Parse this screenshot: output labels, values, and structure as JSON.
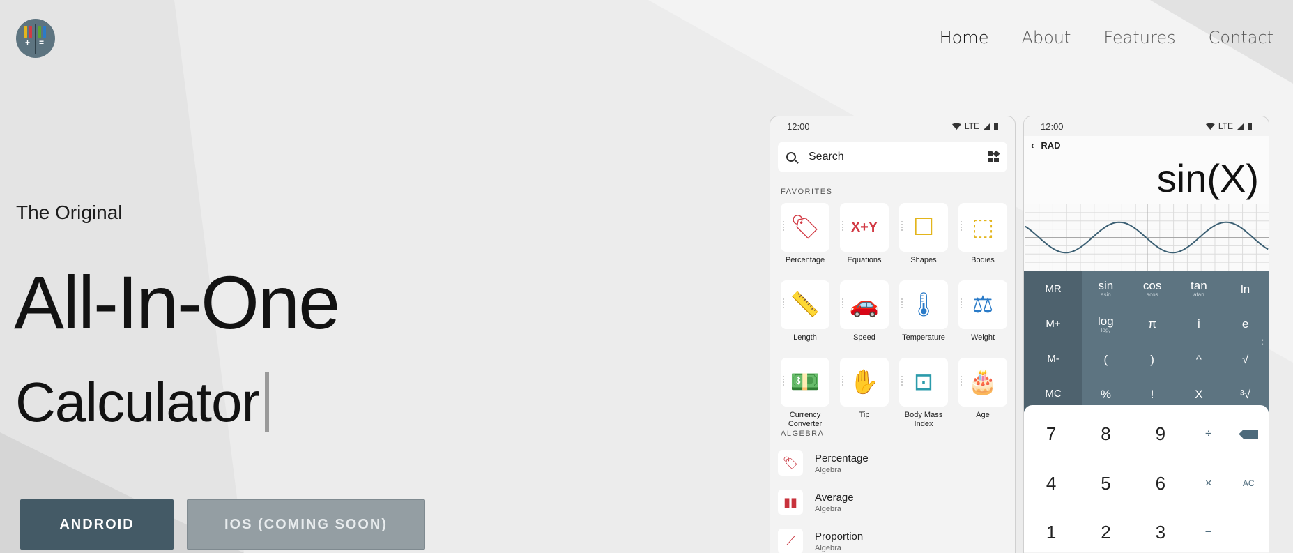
{
  "header": {
    "nav": [
      {
        "label": "Home",
        "active": true
      },
      {
        "label": "About",
        "active": false
      },
      {
        "label": "Features",
        "active": false
      },
      {
        "label": "Contact",
        "active": false
      }
    ]
  },
  "hero": {
    "kicker": "The Original",
    "title_line1": "All-In-One",
    "title_line2": "Calculator",
    "buttons": {
      "android": "ANDROID",
      "ios": "IOS (COMING SOON)"
    }
  },
  "phone1": {
    "time": "12:00",
    "network": "LTE",
    "search_label": "Search",
    "favorites_heading": "FAVORITES",
    "tiles": [
      {
        "label": "Percentage",
        "icon": "percentage-tag-icon",
        "glyph": "🏷",
        "color": "#d23a44"
      },
      {
        "label": "Equations",
        "icon": "equations-icon",
        "glyph": "X+Y",
        "color": "#d23a44"
      },
      {
        "label": "Shapes",
        "icon": "square-icon",
        "glyph": "☐",
        "color": "#e3b51c"
      },
      {
        "label": "Bodies",
        "icon": "cube-icon",
        "glyph": "⬚",
        "color": "#e3b51c"
      },
      {
        "label": "Length",
        "icon": "ruler-icon",
        "glyph": "📏",
        "color": "#2a7bc8"
      },
      {
        "label": "Speed",
        "icon": "car-icon",
        "glyph": "🚗",
        "color": "#2a7bc8"
      },
      {
        "label": "Temperature",
        "icon": "thermometer-icon",
        "glyph": "🌡",
        "color": "#2a7bc8"
      },
      {
        "label": "Weight",
        "icon": "weight-icon",
        "glyph": "⚖",
        "color": "#2a7bc8"
      },
      {
        "label": "Currency Converter",
        "icon": "money-icon",
        "glyph": "💵",
        "color": "#5ea332"
      },
      {
        "label": "Tip",
        "icon": "tip-hand-icon",
        "glyph": "✋",
        "color": "#5ea332"
      },
      {
        "label": "Body Mass Index",
        "icon": "scale-icon",
        "glyph": "⊡",
        "color": "#2b9bab"
      },
      {
        "label": "Age",
        "icon": "cake-icon",
        "glyph": "🎂",
        "color": "#666666"
      }
    ],
    "algebra_heading": "ALGEBRA",
    "list": [
      {
        "title": "Percentage",
        "subtitle": "Algebra",
        "icon": "percentage-tag-icon"
      },
      {
        "title": "Average",
        "subtitle": "Algebra",
        "icon": "bar-chart-icon"
      },
      {
        "title": "Proportion",
        "subtitle": "Algebra",
        "icon": "proportion-icon"
      }
    ]
  },
  "phone2": {
    "time": "12:00",
    "network": "LTE",
    "mode": "RAD",
    "expression": "sin(X)",
    "memory_keys": [
      "MR",
      "M+",
      "M-",
      "MC"
    ],
    "sci_keys": [
      {
        "main": "sin",
        "sub": "asin"
      },
      {
        "main": "cos",
        "sub": "acos"
      },
      {
        "main": "tan",
        "sub": "atan"
      },
      {
        "main": "ln",
        "sub": ""
      },
      {
        "main": "log",
        "sub": "logᵧ"
      },
      {
        "main": "π",
        "sub": ""
      },
      {
        "main": "i",
        "sub": ""
      },
      {
        "main": "e",
        "sub": ""
      },
      {
        "main": "(",
        "sub": ""
      },
      {
        "main": ")",
        "sub": ""
      },
      {
        "main": "^",
        "sub": ""
      },
      {
        "main": "√",
        "sub": ""
      },
      {
        "main": "%",
        "sub": ""
      },
      {
        "main": "!",
        "sub": ""
      },
      {
        "main": "X",
        "sub": ""
      },
      {
        "main": "³√",
        "sub": ""
      }
    ],
    "num_keys": [
      "7",
      "8",
      "9",
      "4",
      "5",
      "6",
      "1",
      "2",
      "3"
    ],
    "op_keys": [
      "÷",
      "",
      "×",
      "AC",
      "−",
      ""
    ]
  },
  "colors": {
    "primary_button": "#445a66",
    "keypad": "#5d7481",
    "memory_column": "#4e626e"
  }
}
